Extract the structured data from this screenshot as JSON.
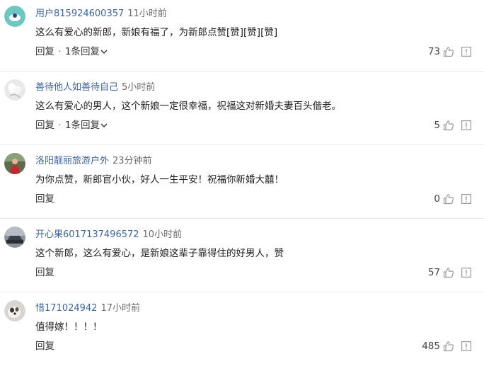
{
  "comments": [
    {
      "username": "用户815924600357",
      "time": "11小时前",
      "text": "这么有爱心的新郎，新娘有福了，为新郎点赞[赞][赞][赞]",
      "reply_label": "回复",
      "separator": "·",
      "replies_label": "1条回复",
      "likes": "73",
      "avatar": "teal-circle-avatar"
    },
    {
      "username": "善待他人如善待自己",
      "time": "5小时前",
      "text": "这么有爱心的男人，这个新娘一定很幸福，祝福这对新婚夫妻百头偕老。",
      "reply_label": "回复",
      "separator": "·",
      "replies_label": "1条回复",
      "likes": "5",
      "avatar": "white-flower-avatar"
    },
    {
      "username": "洛阳靓丽旅游户外",
      "time": "23分钟前",
      "text": "为你点赞，新郎官小伙，好人一生平安！祝福你新婚大囍！",
      "reply_label": "回复",
      "likes": "0",
      "avatar": "person-outdoor-avatar"
    },
    {
      "username": "开心果6017137496572",
      "time": "10小时前",
      "text": "这个新郎，这么有爱心，是新娘这辈子靠得住的好男人，赞",
      "reply_label": "回复",
      "likes": "57",
      "avatar": "car-photo-avatar"
    },
    {
      "username": "惜171024942",
      "time": "17小时前",
      "text": "值得嫁！！！！",
      "reply_label": "回复",
      "likes": "485",
      "avatar": "pet-photo-avatar"
    }
  ]
}
